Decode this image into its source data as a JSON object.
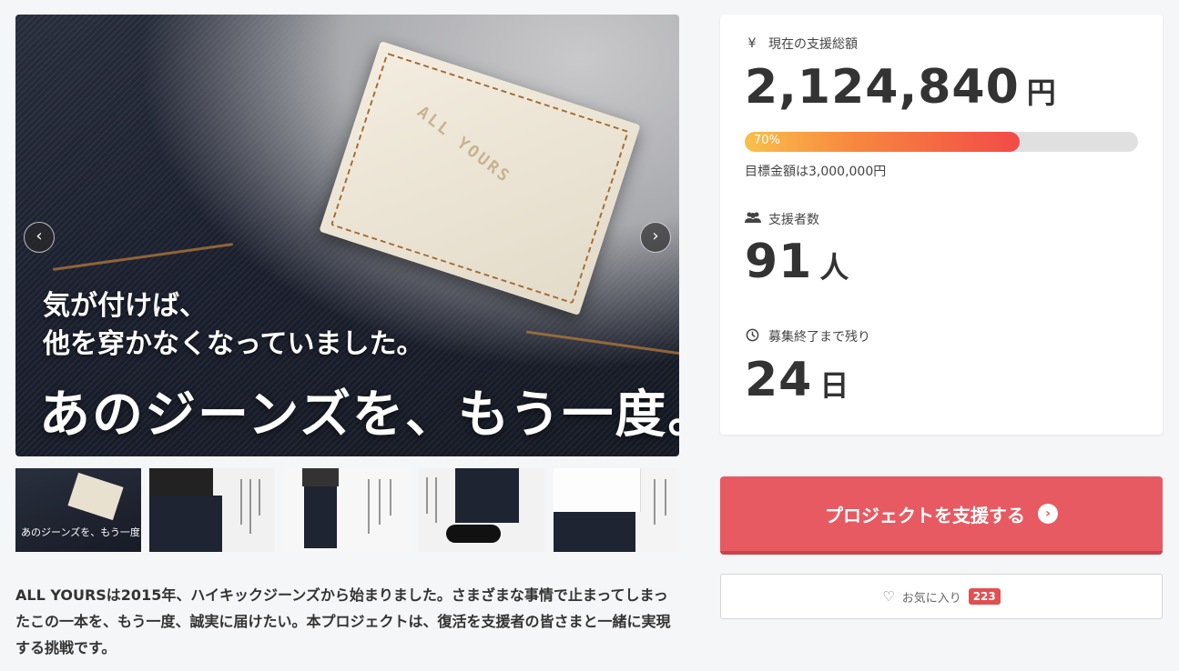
{
  "hero": {
    "line1": "気が付けば、\n他を穿かなくなっていました。",
    "line2": "あのジーンズを、もう一度。",
    "patch_text": "ALL YOURS",
    "prev_icon": "chevron-left-icon",
    "next_icon": "chevron-right-icon"
  },
  "thumbs": {
    "t0_text": "あのジーンズを、もう一度"
  },
  "description": "ALL YOURSは2015年、ハイキックジーンズから始まりました。さまざまな事情で止まってしまったこの一本を、もう一度、誠実に届けたい。本プロジェクトは、復活を支援者の皆さまと一緒に実現する挑戦です。",
  "stats": {
    "total_label": "現在の支援総額",
    "total_icon": "¥",
    "total_value": "2,124,840",
    "total_unit": "円",
    "progress_text": "70%",
    "progress_fraction": 0.7,
    "goal_text": "目標金額は3,000,000円",
    "backers_label": "支援者数",
    "backers_value": "91",
    "backers_unit": "人",
    "remaining_label": "募集終了まで残り",
    "remaining_value": "24",
    "remaining_unit": "日"
  },
  "actions": {
    "support_label": "プロジェクトを支援する",
    "favorite_label": "お気に入り",
    "favorite_count": "223"
  },
  "colors": {
    "support_button": "#e75a62",
    "favorite_badge": "#e24f4f",
    "progress_start": "#f9c04b",
    "progress_end": "#f24a47"
  }
}
